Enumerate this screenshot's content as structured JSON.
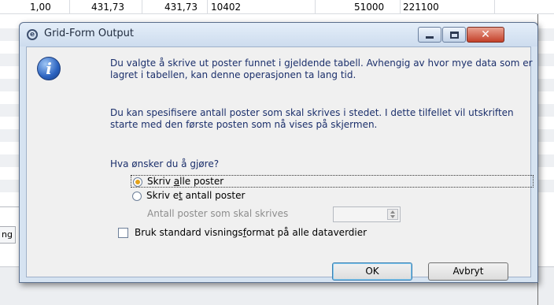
{
  "background": {
    "row_values": [
      "1,00",
      "431,73",
      "431,73",
      "10402",
      "51000",
      "221100"
    ],
    "left_tab_label": "ng"
  },
  "dialog": {
    "title": "Grid-Form Output",
    "paragraph1": "Du valgte å skrive ut poster funnet i gjeldende tabell. Avhengig av hvor mye data som er lagret i tabellen, kan denne operasjonen ta lang tid.",
    "paragraph2": "Du kan spesifisere antall poster som skal skrives i stedet. I dette tilfellet vil utskriften starte med den første posten som nå vises på skjermen.",
    "question": "Hva ønsker du å gjøre?",
    "option_all": {
      "pre": "Skriv ",
      "key": "a",
      "post": "lle poster",
      "selected": true
    },
    "option_count": {
      "pre": "Skriv e",
      "key": "t",
      "post": " antall poster",
      "selected": false
    },
    "count_label": "Antall poster som skal skrives",
    "count_value": "",
    "checkbox": {
      "pre": "Bruk standard visnings",
      "key": "f",
      "post": "ormat på alle dataverdier",
      "checked": false
    },
    "ok_label": "OK",
    "cancel_label": "Avbryt"
  },
  "colors": {
    "accent": "#e3a21a",
    "text_blue": "#1b2f6b",
    "close_red": "#c4412a"
  }
}
